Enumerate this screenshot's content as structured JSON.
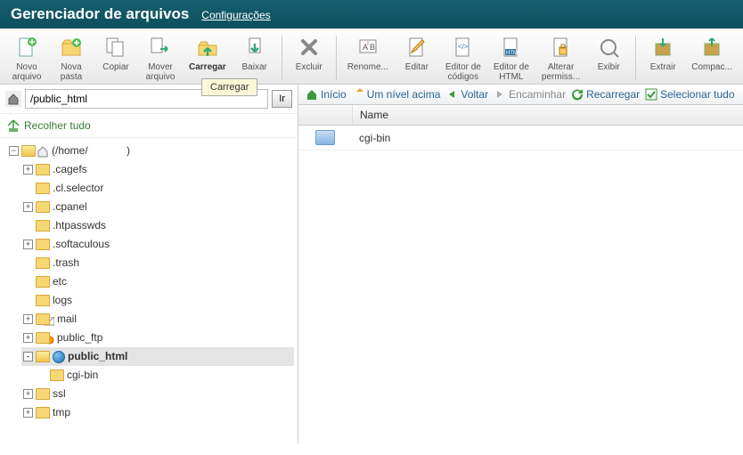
{
  "header": {
    "title": "Gerenciador de arquivos",
    "settings": "Configurações"
  },
  "toolbar": [
    {
      "label": "Novo\narquivo",
      "icon": "file-plus"
    },
    {
      "label": "Nova\npasta",
      "icon": "folder-plus"
    },
    {
      "label": "Copiar",
      "icon": "copy"
    },
    {
      "label": "Mover\narquivo",
      "icon": "move"
    },
    {
      "label": "Carregar",
      "icon": "upload",
      "selected": true
    },
    {
      "label": "Baixar",
      "icon": "download"
    },
    {
      "sep": true
    },
    {
      "label": "Excluir",
      "icon": "delete"
    },
    {
      "sep": true
    },
    {
      "label": "Renome...",
      "icon": "rename"
    },
    {
      "label": "Editar",
      "icon": "edit"
    },
    {
      "label": "Editor de\ncódigos",
      "icon": "code-editor"
    },
    {
      "label": "Editor de\nHTML",
      "icon": "html-editor"
    },
    {
      "label": "Alterar\npermiss...",
      "icon": "permissions"
    },
    {
      "label": "Exibir",
      "icon": "view"
    },
    {
      "sep": true
    },
    {
      "label": "Extrair",
      "icon": "extract"
    },
    {
      "label": "Compac...",
      "icon": "compress"
    }
  ],
  "tooltip": "Carregar",
  "path": {
    "value": "/public_html",
    "go": "Ir"
  },
  "collapse": "Recolher tudo",
  "crumbs": [
    {
      "label": "Início",
      "color": "#2a8a2a"
    },
    {
      "label": "Um nível acima",
      "color": "#d48a1a"
    },
    {
      "label": "Voltar",
      "color": "#2a8a2a"
    },
    {
      "label": "Encaminhar",
      "color": "#888"
    },
    {
      "label": "Recarregar",
      "color": "#2a8a2a"
    },
    {
      "label": "Selecionar tudo",
      "color": "#2a8a2a"
    }
  ],
  "columns": {
    "name": "Name"
  },
  "tree": {
    "root": {
      "label": "(/home/",
      "suffix": ")"
    },
    "children": [
      {
        "label": ".cagefs",
        "exp": "+"
      },
      {
        "label": ".cl.selector"
      },
      {
        "label": ".cpanel",
        "exp": "+"
      },
      {
        "label": ".htpasswds"
      },
      {
        "label": ".softaculous",
        "exp": "+"
      },
      {
        "label": ".trash"
      },
      {
        "label": "etc"
      },
      {
        "label": "logs"
      },
      {
        "label": "mail",
        "exp": "+",
        "ictype": "mail"
      },
      {
        "label": "public_ftp",
        "exp": "+",
        "ictype": "ftp"
      },
      {
        "label": "public_html",
        "exp": "-",
        "ictype": "globe",
        "selected": true,
        "children": [
          {
            "label": "cgi-bin"
          }
        ]
      },
      {
        "label": "ssl",
        "exp": "+"
      },
      {
        "label": "tmp",
        "exp": "+"
      }
    ]
  },
  "rows": [
    {
      "name": "cgi-bin",
      "type": "folder"
    }
  ]
}
